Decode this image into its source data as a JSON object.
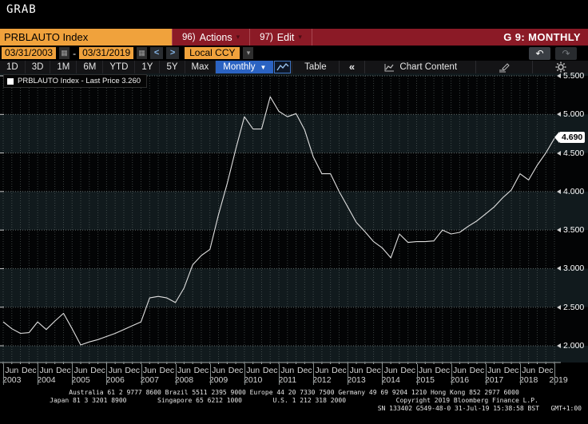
{
  "window": {
    "title": "GRAB"
  },
  "header": {
    "security_field": "PRBLAUTO Index",
    "actions_num": "96)",
    "actions_label": "Actions",
    "edit_num": "97)",
    "edit_label": "Edit",
    "menu_caret": "▾",
    "page_label": "G 9: MONTHLY"
  },
  "range_bar": {
    "start_date": "03/31/2003",
    "separator": "-",
    "end_date": "03/31/2019",
    "calendar_icon": "▦",
    "prev_arrow": "<",
    "next_arrow": ">",
    "currency": "Local CCY",
    "dropdown_caret": "▾",
    "undo_icon": "↶",
    "redo_icon": "↷"
  },
  "toolbar": {
    "periods": [
      "1D",
      "3D",
      "1M",
      "6M",
      "YTD",
      "1Y",
      "5Y",
      "Max"
    ],
    "frequency": "Monthly",
    "frequency_caret": "▼",
    "table_label": "Table",
    "collapse_label": "«",
    "chart_content_label": "Chart Content"
  },
  "legend": {
    "swatch_color": "#ffffff",
    "label": "PRBLAUTO Index - Last Price 3.260"
  },
  "colors": {
    "cmdbar_red": "#8b1a26",
    "field_orange": "#f0a23c",
    "freq_blue": "#2b63c2",
    "band_teal": "#111a1d",
    "band_black": "#030405",
    "line": "#dfdfdf",
    "badge_bg": "#ffffff"
  },
  "chart_data": {
    "type": "line",
    "series_name": "PRBLAUTO Index - Last Price",
    "legend_last_price": "3.260",
    "axis_badge_value": "4.690",
    "frequency": "quarterly points, Mar 2003 - Mar 2019",
    "x_start_year": 2003,
    "x_end_year": 2019,
    "values": [
      2.31,
      2.22,
      2.16,
      2.17,
      2.31,
      2.21,
      2.32,
      2.42,
      2.22,
      2.01,
      2.05,
      2.08,
      2.12,
      2.16,
      2.21,
      2.26,
      2.31,
      2.62,
      2.64,
      2.62,
      2.56,
      2.75,
      3.05,
      3.17,
      3.25,
      3.7,
      4.1,
      4.55,
      4.97,
      4.81,
      4.81,
      5.23,
      5.04,
      4.97,
      5.01,
      4.8,
      4.45,
      4.23,
      4.23,
      4.0,
      3.8,
      3.6,
      3.48,
      3.35,
      3.27,
      3.14,
      3.45,
      3.34,
      3.35,
      3.35,
      3.36,
      3.5,
      3.45,
      3.47,
      3.55,
      3.62,
      3.71,
      3.8,
      3.92,
      4.02,
      4.23,
      4.15,
      4.34,
      4.5,
      4.69
    ],
    "ylim": [
      1.78,
      5.53
    ],
    "y_tick_labels": [
      "5.500",
      "5.000",
      "4.500",
      "4.000",
      "3.500",
      "3.000",
      "2.500",
      "2.000"
    ],
    "badge_value_numeric": 4.69,
    "x_month_cycle": [
      "Jun",
      "Dec"
    ],
    "years": [
      "2003",
      "2004",
      "2005",
      "2006",
      "2007",
      "2008",
      "2009",
      "2010",
      "2011",
      "2012",
      "2013",
      "2014",
      "2015",
      "2016",
      "2017",
      "2018",
      "2019"
    ],
    "grid": true,
    "legend_position": "top-left"
  },
  "footer": {
    "line1": "Australia 61 2 9777 8600 Brazil 5511 2395 9000 Europe 44 20 7330 7500 Germany 49 69 9204 1210 Hong Kong 852 2977 6000",
    "line2": "Japan 81 3 3201 8900        Singapore 65 6212 1000        U.S. 1 212 318 2000             Copyright 2019 Bloomberg Finance L.P.",
    "line3": "SN 133402 G549-48-0 31-Jul-19 15:38:58 BST   GMT+1:00"
  }
}
